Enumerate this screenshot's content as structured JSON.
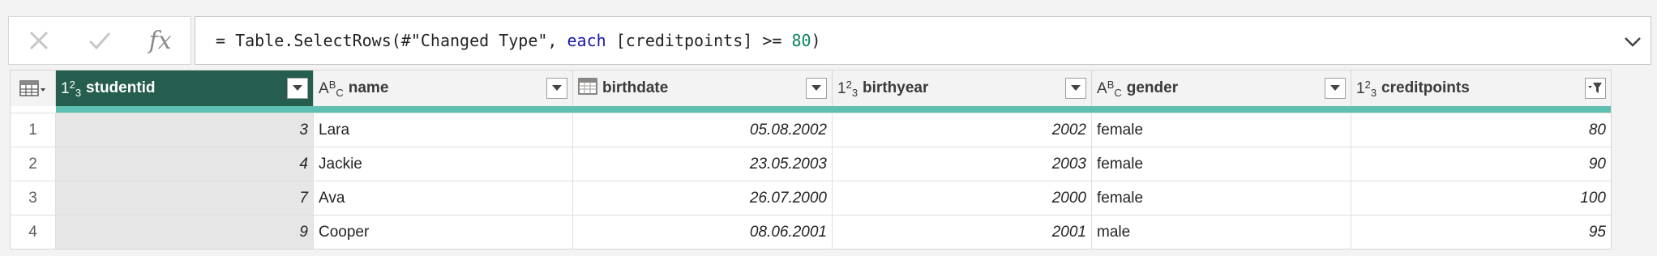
{
  "formula_bar": {
    "cancel_icon": "close-icon",
    "commit_icon": "check-icon",
    "fx_label": "fx",
    "formula_prefix": "= Table.SelectRows(#\"Changed Type\", ",
    "formula_keyword": "each",
    "formula_middle": " [creditpoints] >= ",
    "formula_number": "80",
    "formula_suffix": ")"
  },
  "table": {
    "columns": [
      {
        "type_icon": "123",
        "name": "studentid",
        "selected": true,
        "filtered": false
      },
      {
        "type_icon": "ABC",
        "name": "name",
        "selected": false,
        "filtered": false
      },
      {
        "type_icon": "calendar",
        "name": "birthdate",
        "selected": false,
        "filtered": false
      },
      {
        "type_icon": "123",
        "name": "birthyear",
        "selected": false,
        "filtered": false
      },
      {
        "type_icon": "ABC",
        "name": "gender",
        "selected": false,
        "filtered": false
      },
      {
        "type_icon": "123",
        "name": "creditpoints",
        "selected": false,
        "filtered": true
      }
    ],
    "rows": [
      {
        "n": "1",
        "studentid": "3",
        "name": "Lara",
        "birthdate": "05.08.2002",
        "birthyear": "2002",
        "gender": "female",
        "creditpoints": "80"
      },
      {
        "n": "2",
        "studentid": "4",
        "name": "Jackie",
        "birthdate": "23.05.2003",
        "birthyear": "2003",
        "gender": "female",
        "creditpoints": "90"
      },
      {
        "n": "3",
        "studentid": "7",
        "name": "Ava",
        "birthdate": "26.07.2000",
        "birthyear": "2000",
        "gender": "female",
        "creditpoints": "100"
      },
      {
        "n": "4",
        "studentid": "9",
        "name": "Cooper",
        "birthdate": "08.06.2001",
        "birthyear": "2001",
        "gender": "male",
        "creditpoints": "95"
      }
    ]
  },
  "colors": {
    "selected_header": "#255d4e",
    "quality_bar": "#5fbfb0",
    "keyword": "#1a1aa6",
    "number": "#098658"
  }
}
